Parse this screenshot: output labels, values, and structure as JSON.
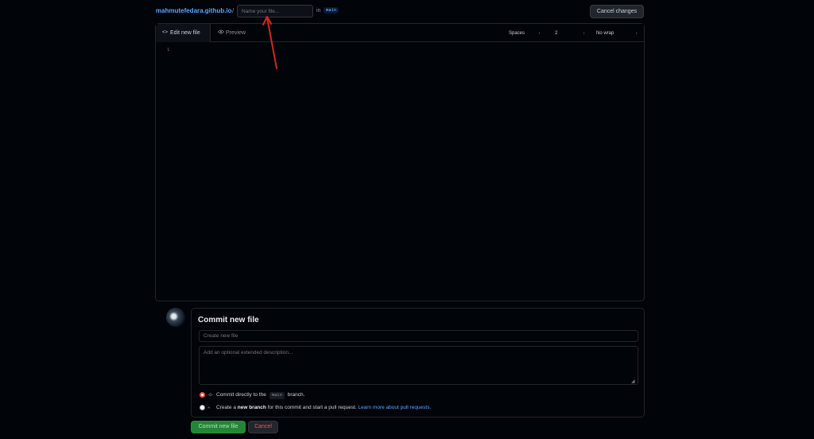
{
  "header": {
    "repo_name": "mahmutefedara.github.io",
    "separator": "/",
    "filename_placeholder": "Name your file...",
    "in_label": "in",
    "branch": "main",
    "cancel_changes_label": "Cancel changes"
  },
  "editor": {
    "tabs": [
      {
        "label": "Edit new file",
        "icon": "code-icon",
        "active": true
      },
      {
        "label": "Preview",
        "icon": "eye-icon",
        "active": false
      }
    ],
    "indent_mode": "Spaces",
    "indent_size": "2",
    "wrap_mode": "No wrap",
    "line_numbers": [
      "1"
    ]
  },
  "commit": {
    "title": "Commit new file",
    "message_placeholder": "Create new file",
    "description_placeholder": "Add an optional extended description...",
    "options": {
      "direct": {
        "text_before": "Commit directly to the",
        "branch": "main",
        "text_after": "branch.",
        "checked": true
      },
      "new_branch": {
        "text_before": "Create a",
        "bold_text": "new branch",
        "text_after": "for this commit and start a pull request.",
        "link_text": "Learn more about pull requests.",
        "checked": false
      }
    },
    "submit_label": "Commit new file",
    "cancel_label": "Cancel"
  },
  "colors": {
    "background": "#010409",
    "link": "#58a6ff",
    "commit_button": "#238636",
    "cancel_text": "#f85149",
    "annotation_arrow": "#d7261c"
  }
}
